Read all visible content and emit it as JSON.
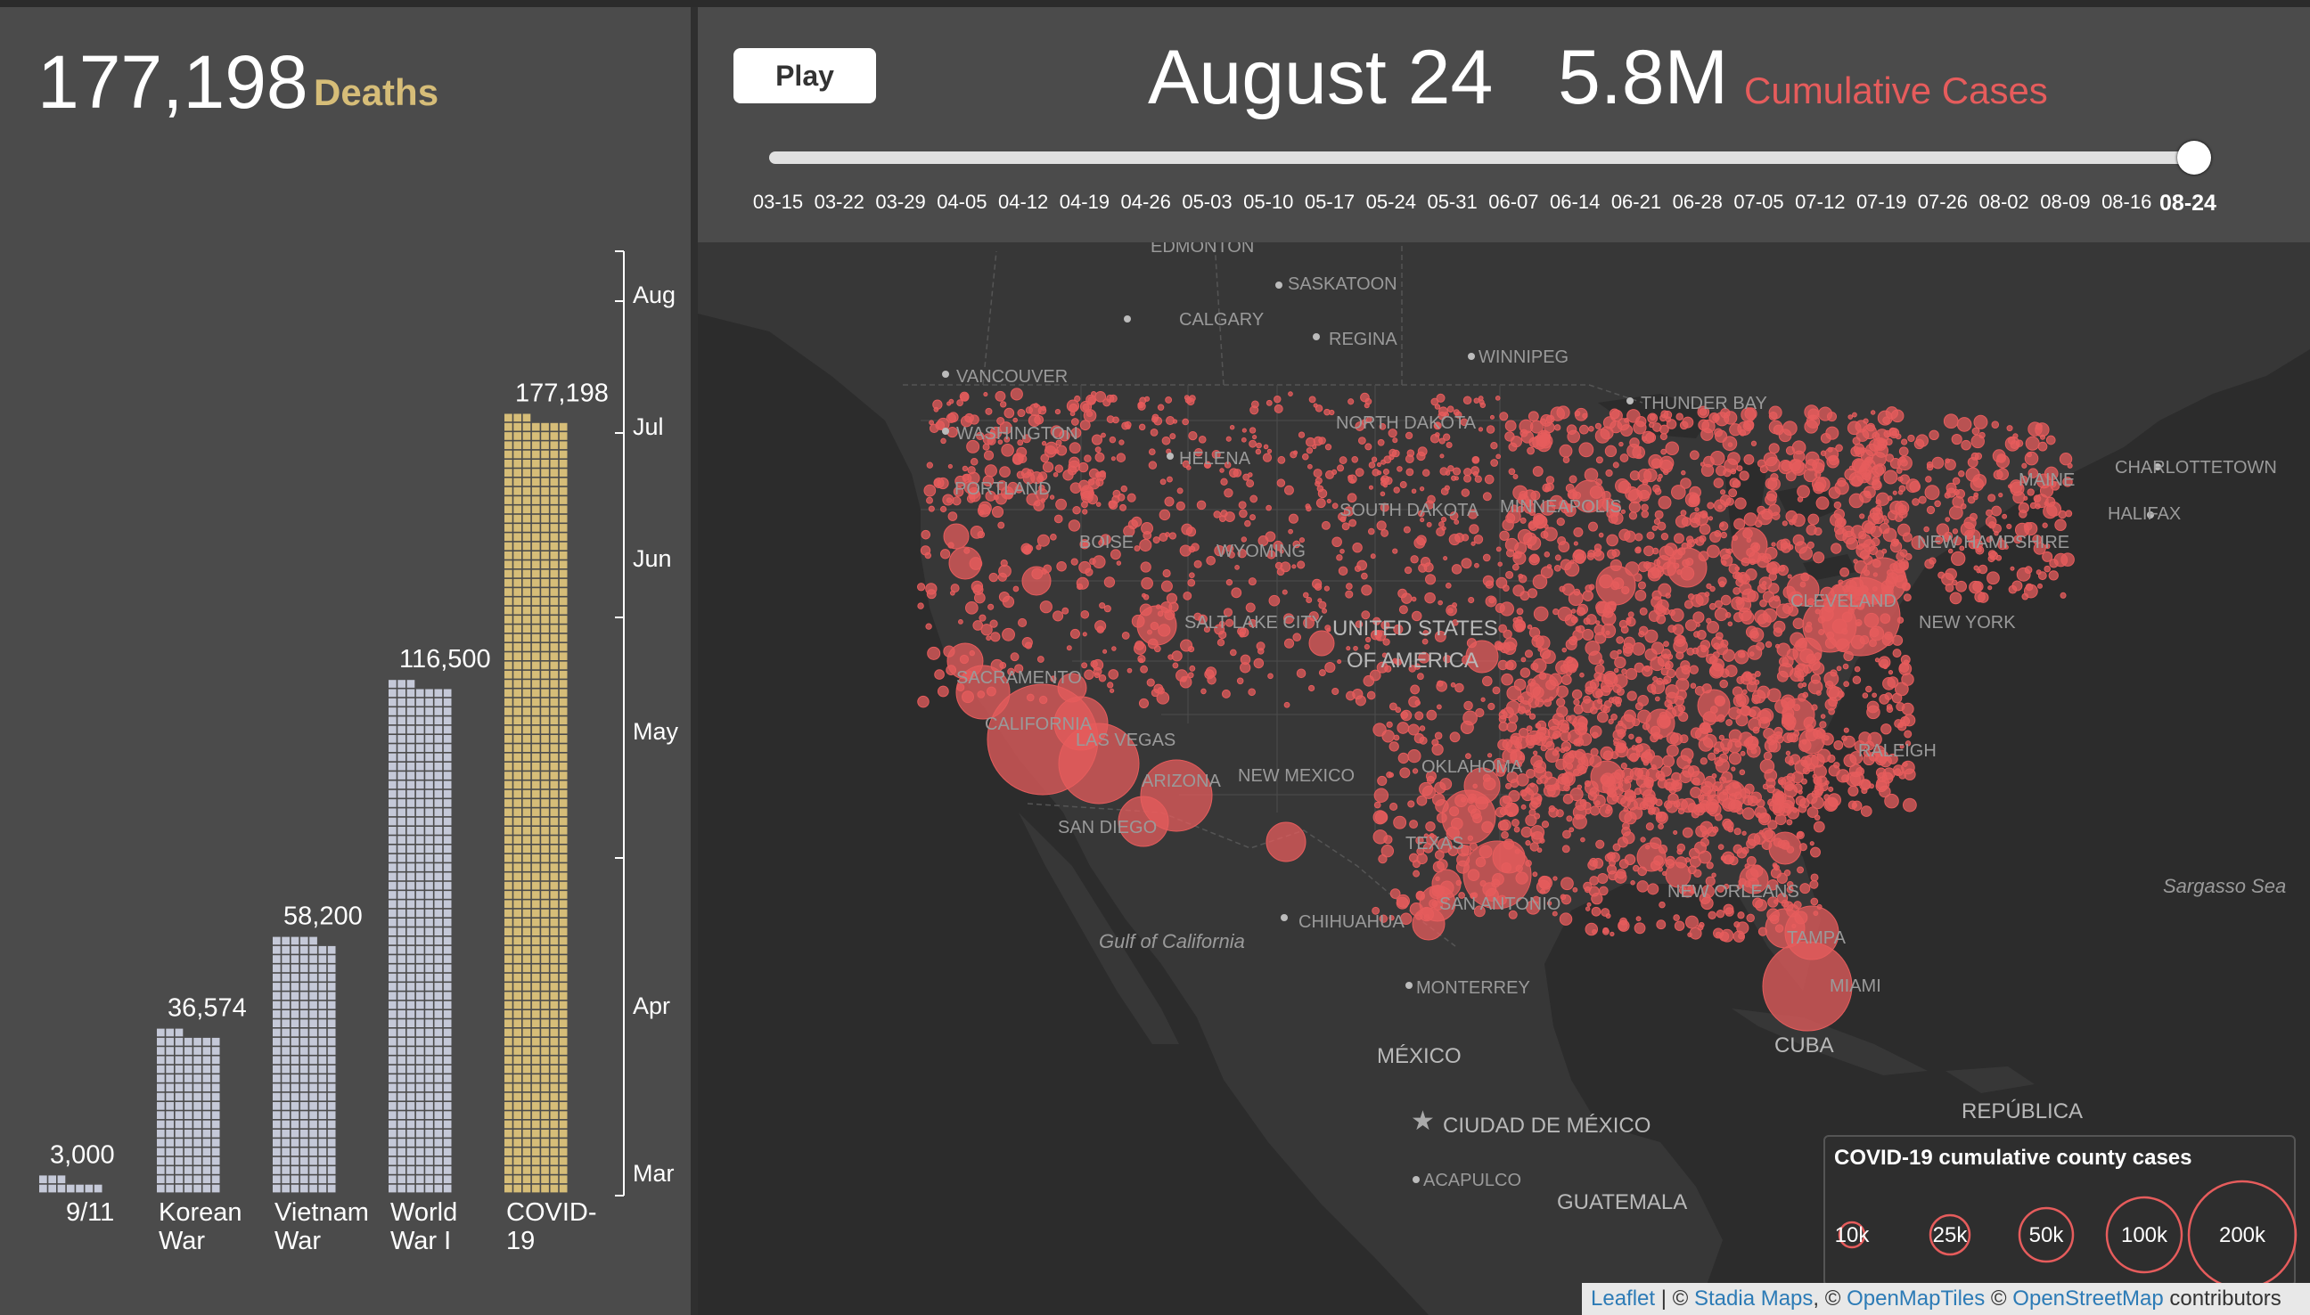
{
  "deaths": {
    "count": "177,198",
    "label": "Deaths"
  },
  "header": {
    "play_label": "Play",
    "date": "August 24",
    "cases_value": "5.8M",
    "cases_label": "Cumulative Cases",
    "slider_ticks": [
      "03-15",
      "03-22",
      "03-29",
      "04-05",
      "04-12",
      "04-19",
      "04-26",
      "05-03",
      "05-10",
      "05-17",
      "05-24",
      "05-31",
      "06-07",
      "06-14",
      "06-21",
      "06-28",
      "07-05",
      "07-12",
      "07-19",
      "07-26",
      "08-02",
      "08-09",
      "08-16",
      "08-24"
    ],
    "slider_active": "08-24",
    "slider_position": 1.0
  },
  "chart_data": {
    "type": "bar",
    "title": "",
    "categories": [
      "9/11",
      "Korean War",
      "Vietnam War",
      "World War I",
      "COVID-19"
    ],
    "category_lines": [
      [
        "9/11"
      ],
      [
        "Korean",
        "War"
      ],
      [
        "Vietnam",
        "War"
      ],
      [
        "World",
        "War I"
      ],
      [
        "COVID-",
        "19"
      ]
    ],
    "values": [
      3000,
      36574,
      58200,
      116500,
      177198
    ],
    "value_labels": [
      "3,000",
      "36,574",
      "58,200",
      "116,500",
      "177,198"
    ],
    "colors": [
      "#c5c9d8",
      "#c5c9d8",
      "#c5c9d8",
      "#c5c9d8",
      "#d6bd78"
    ],
    "month_axis": [
      "Mar",
      "Apr",
      "May",
      "Jun",
      "Jul",
      "Aug"
    ],
    "legend": "none",
    "grid": false
  },
  "map": {
    "labels": {
      "edmonton": "EDMONTON",
      "saskatoon": "SASKATOON",
      "calgary": "CALGARY",
      "regina": "REGINA",
      "winnipeg": "WINNIPEG",
      "vancouver": "VANCOUVER",
      "thunder_bay": "THUNDER BAY",
      "washington": "WASHINGTON",
      "portland": "PORTLAND",
      "north_dakota": "NORTH DAKOTA",
      "helena": "HELENA",
      "south_dakota": "SOUTH DAKOTA",
      "minneapolis": "MINNEAPOLIS",
      "maine": "MAINE",
      "charlottetown": "CHARLOTTETOWN",
      "halifax": "HALIFAX",
      "boise": "BOISE",
      "wyoming": "WYOMING",
      "new_hampshire": "NEW HAMPSHIRE",
      "cleveland": "CLEVELAND",
      "new_york": "NEW YORK",
      "salt_lake_city": "SALT LAKE CITY",
      "united_states_1": "UNITED STATES",
      "united_states_2": "OF AMERICA",
      "sacramento": "SACRAMENTO",
      "california": "CALIFORNIA",
      "las_vegas": "LAS VEGAS",
      "arizona": "ARIZONA",
      "new_mexico": "NEW MEXICO",
      "oklahoma": "OKLAHOMA",
      "raleigh": "RALEIGH",
      "san_diego": "SAN DIEGO",
      "texas": "TEXAS",
      "new_orleans": "NEW ORLEANS",
      "san_antonio": "SAN ANTONIO",
      "chihuahua": "CHIHUAHUA",
      "tampa": "TAMPA",
      "miami": "MIAMI",
      "monterrey": "MONTERREY",
      "cuba": "CUBA",
      "mexico": "MÉXICO",
      "ciudad_mexico": "CIUDAD DE MÉXICO",
      "acapulco": "ACAPULCO",
      "guatemala": "GUATEMALA",
      "republica": "REPÚBLICA",
      "gulf_california": "Gulf of California",
      "sargasso": "Sargasso Sea"
    },
    "legend": {
      "title": "COVID-19 cumulative county cases",
      "items": [
        "10k",
        "25k",
        "50k",
        "100k",
        "200k"
      ]
    },
    "attribution": {
      "leaflet": "Leaflet",
      "sep1": " | © ",
      "stadia": "Stadia Maps",
      "sep2": ", © ",
      "openmaptiles": "OpenMapTiles",
      "sep3": " © ",
      "osm": "OpenStreetMap",
      "tail": " contributors"
    },
    "bubble_color": "#e65c5c"
  }
}
